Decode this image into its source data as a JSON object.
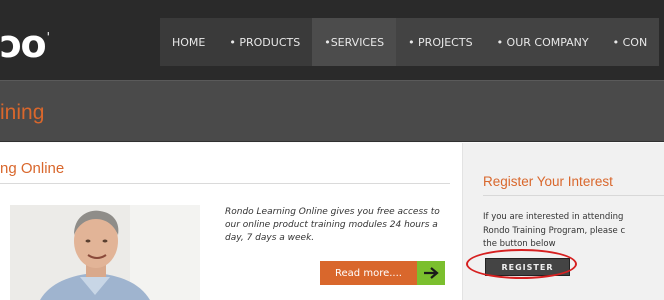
{
  "logo": {
    "text": "ɔo",
    "mark": "'"
  },
  "nav": {
    "items": [
      {
        "label": "HOME"
      },
      {
        "label": "• PRODUCTS"
      },
      {
        "label": "•SERVICES"
      },
      {
        "label": "• PROJECTS"
      },
      {
        "label": "• OUR COMPANY"
      },
      {
        "label": "• CON"
      }
    ]
  },
  "page": {
    "title": "ining"
  },
  "main": {
    "heading": "ng Online",
    "description": "Rondo Learning Online gives you free access to our online product training modules 24 hours a day, 7 days a week.",
    "read_more_label": "Read more....",
    "read_more_icon": "arrow-right-icon"
  },
  "sidebar": {
    "heading": "Register Your Interest",
    "text_lines": [
      "If you are interested in attending",
      "Rondo Training Program, please c",
      "the  button below"
    ],
    "register_label": "REGISTER"
  },
  "colors": {
    "accent": "#d9672c",
    "header_bg": "#2a2a2a",
    "titlebar_bg": "#4a4a4a",
    "arrow_green": "#7bbf2e",
    "highlight_red": "#d62020"
  }
}
